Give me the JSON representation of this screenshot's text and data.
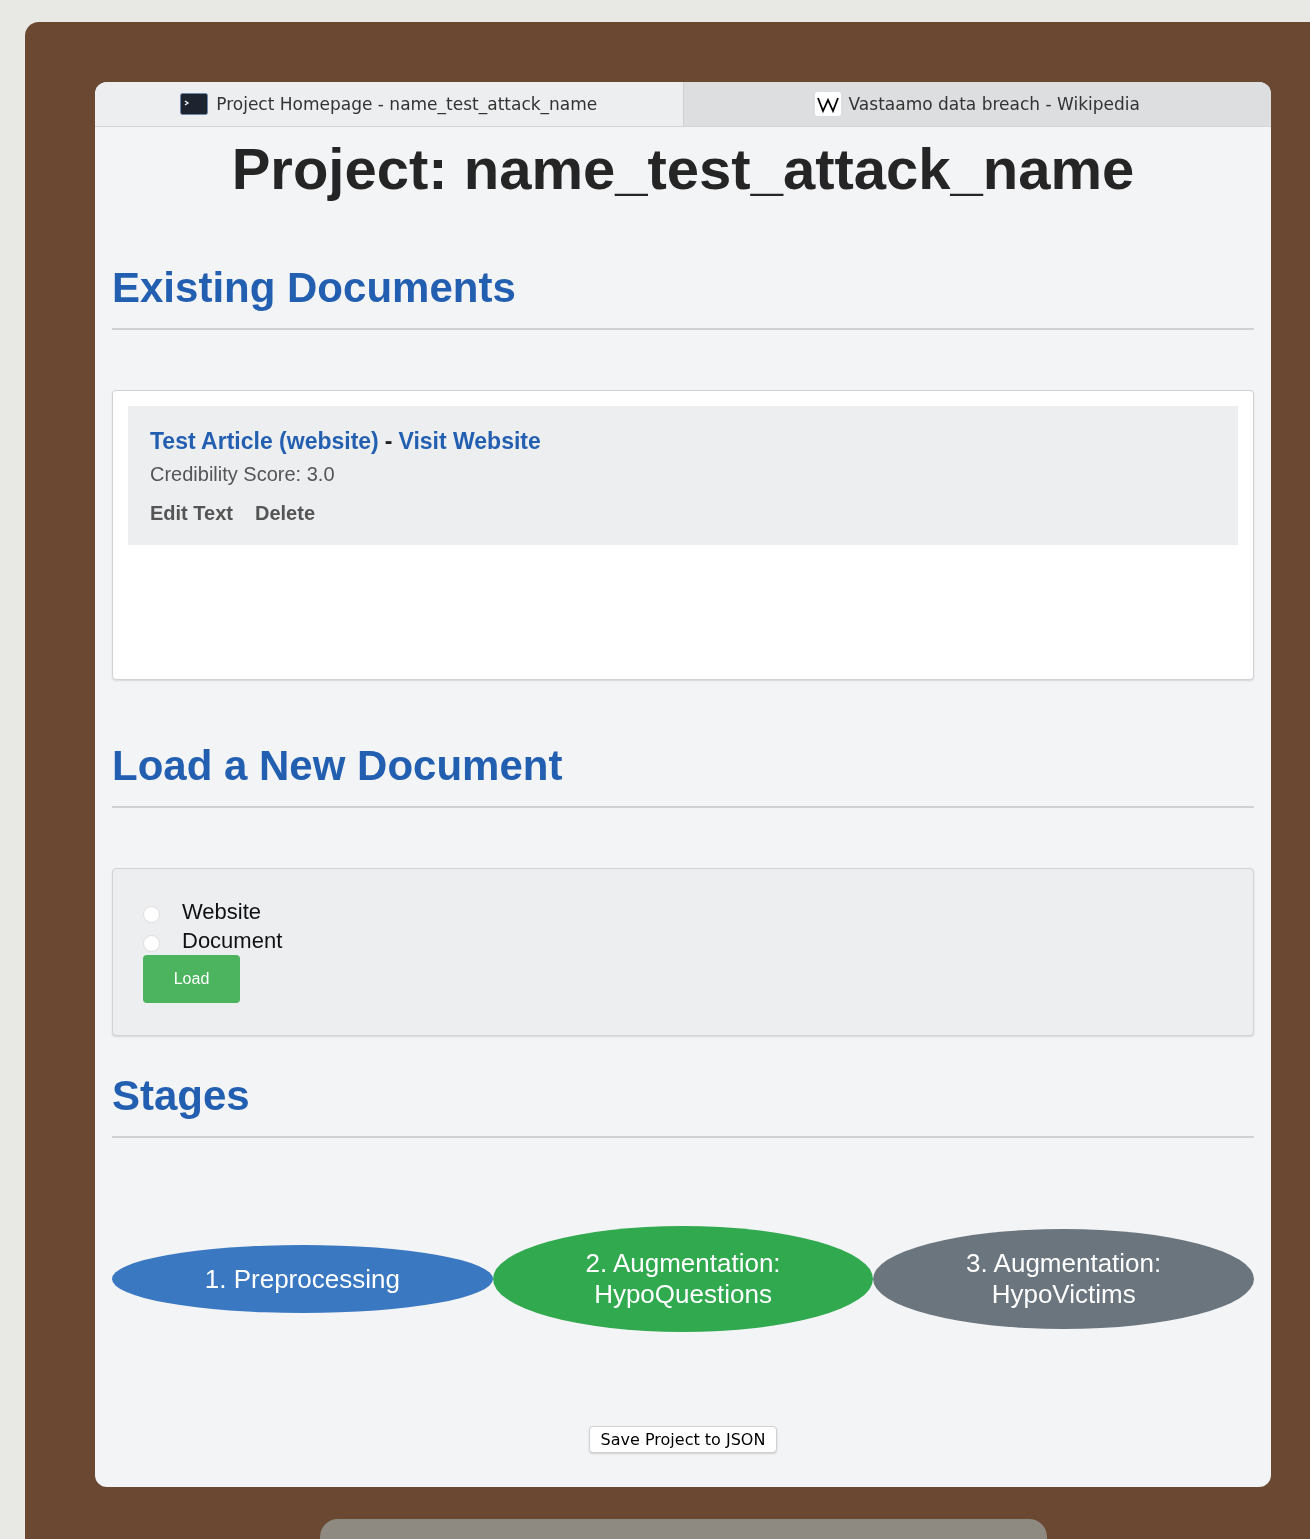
{
  "tabs": [
    {
      "label": "Project Homepage - name_test_attack_name",
      "selected": true
    },
    {
      "label": "Vastaamo data breach - Wikipedia",
      "selected": false
    }
  ],
  "title": "Project: name_test_attack_name",
  "existing": {
    "heading": "Existing Documents",
    "documents": [
      {
        "name": "Test Article (website)",
        "separator": "-",
        "link": "Visit Website",
        "score": "Credibility Score: 3.0",
        "actions": [
          "Edit Text",
          "Delete"
        ]
      }
    ]
  },
  "load": {
    "heading": "Load a New Document",
    "options": [
      {
        "label": "Website",
        "selected": false
      },
      {
        "label": "Document",
        "selected": false
      }
    ],
    "button": "Load"
  },
  "stages": {
    "heading": "Stages",
    "items": [
      {
        "label": "1. Preprocessing",
        "color": "#3a78c2"
      },
      {
        "label": "2. Augmentation: HypoQuestions",
        "color": "#31a94f"
      },
      {
        "label": "3. Augmentation: HypoVictims",
        "color": "#6b757e"
      }
    ]
  },
  "save_button": "Save Project to JSON"
}
